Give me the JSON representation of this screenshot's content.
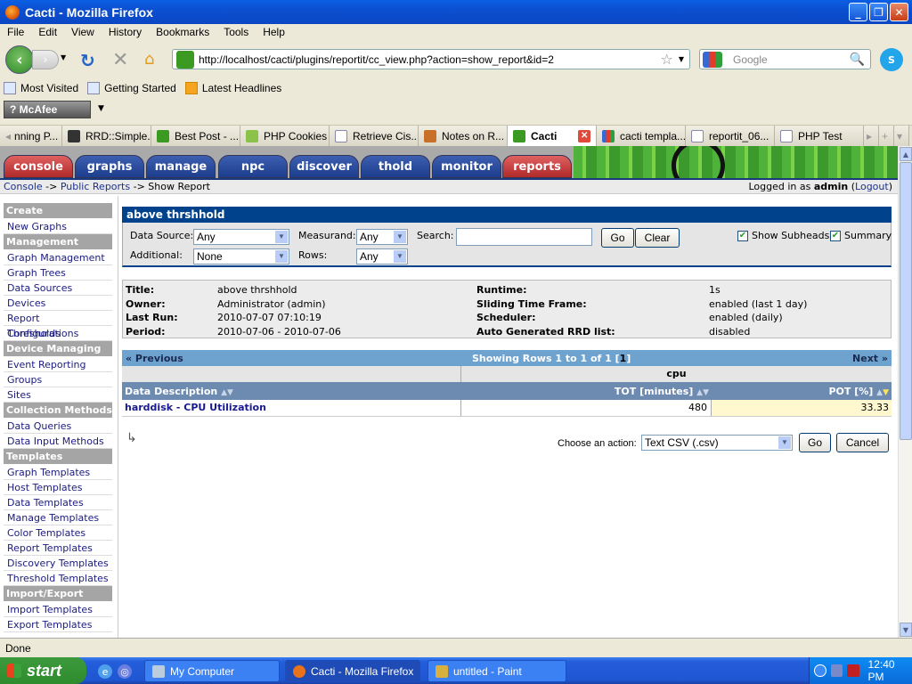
{
  "window": {
    "title": "Cacti - Mozilla Firefox"
  },
  "menu": [
    "File",
    "Edit",
    "View",
    "History",
    "Bookmarks",
    "Tools",
    "Help"
  ],
  "url": "http://localhost/cacti/plugins/reportit/cc_view.php?action=show_report&id=2",
  "search_placeholder": "Google",
  "bookmarks": [
    "Most Visited",
    "Getting Started",
    "Latest Headlines"
  ],
  "mcafee_label": "McAfee",
  "tabs": [
    {
      "label": "nning P..."
    },
    {
      "label": "RRD::Simple..."
    },
    {
      "label": "Best Post - ..."
    },
    {
      "label": "PHP Cookies"
    },
    {
      "label": "Retrieve Cis..."
    },
    {
      "label": "Notes on R..."
    },
    {
      "label": "Cacti",
      "active": true
    },
    {
      "label": "cacti templa..."
    },
    {
      "label": "reportit_06..."
    },
    {
      "label": "PHP Test"
    }
  ],
  "cacti_tabs": [
    "console",
    "graphs",
    "manage",
    "npc",
    "discover",
    "thold",
    "monitor",
    "reports"
  ],
  "breadcrumb": {
    "items": [
      "Console",
      "Public Reports"
    ],
    "current": "Show Report",
    "sep": "->"
  },
  "login": {
    "prefix": "Logged in as",
    "user": "admin",
    "logout": "Logout"
  },
  "sidebar": [
    {
      "type": "head",
      "label": "Create"
    },
    {
      "type": "item",
      "label": "New Graphs"
    },
    {
      "type": "head",
      "label": "Management"
    },
    {
      "type": "item",
      "label": "Graph Management"
    },
    {
      "type": "item",
      "label": "Graph Trees"
    },
    {
      "type": "item",
      "label": "Data Sources"
    },
    {
      "type": "item",
      "label": "Devices"
    },
    {
      "type": "item",
      "label": "Report Configurations"
    },
    {
      "type": "item",
      "label": "Thresholds"
    },
    {
      "type": "head",
      "label": "Device Managing"
    },
    {
      "type": "item",
      "label": "Event Reporting"
    },
    {
      "type": "item",
      "label": "Groups"
    },
    {
      "type": "item",
      "label": "Sites"
    },
    {
      "type": "head",
      "label": "Collection Methods"
    },
    {
      "type": "item",
      "label": "Data Queries"
    },
    {
      "type": "item",
      "label": "Data Input Methods"
    },
    {
      "type": "head",
      "label": "Templates"
    },
    {
      "type": "item",
      "label": "Graph Templates"
    },
    {
      "type": "item",
      "label": "Host Templates"
    },
    {
      "type": "item",
      "label": "Data Templates"
    },
    {
      "type": "item",
      "label": "Manage Templates"
    },
    {
      "type": "item",
      "label": "Color Templates"
    },
    {
      "type": "item",
      "label": "Report Templates"
    },
    {
      "type": "item",
      "label": "Discovery Templates"
    },
    {
      "type": "item",
      "label": "Threshold Templates"
    },
    {
      "type": "head",
      "label": "Import/Export"
    },
    {
      "type": "item",
      "label": "Import Templates"
    },
    {
      "type": "item",
      "label": "Export Templates"
    }
  ],
  "report": {
    "title": "above thrshhold",
    "filter": {
      "data_source_label": "Data Source:",
      "data_source": "Any",
      "measurand_label": "Measurand:",
      "measurand": "Any",
      "search_label": "Search:",
      "search_value": "",
      "additional_label": "Additional:",
      "additional": "None",
      "rows_label": "Rows:",
      "rows": "Any",
      "go": "Go",
      "clear": "Clear",
      "show_subheads": "Show Subheads",
      "summary": "Summary"
    },
    "info_left": [
      {
        "label": "Title:",
        "value": "above thrshhold"
      },
      {
        "label": "Owner:",
        "value": "Administrator (admin)"
      },
      {
        "label": "Last Run:",
        "value": "2010-07-07 07:10:19"
      },
      {
        "label": "Period:",
        "value": "2010-07-06 - 2010-07-06"
      }
    ],
    "info_right": [
      {
        "label": "Runtime:",
        "value": "1s"
      },
      {
        "label": "Sliding Time Frame:",
        "value": "enabled (last 1 day)"
      },
      {
        "label": "Scheduler:",
        "value": "enabled (daily)"
      },
      {
        "label": "Auto Generated RRD list:",
        "value": "disabled"
      }
    ],
    "nav": {
      "prev": "« Previous",
      "showing": "Showing Rows 1 to 1 of 1 [",
      "page": "1",
      "close": "]",
      "next": "Next »"
    },
    "subhead": "cpu",
    "columns": [
      "Data Description",
      "TOT [minutes]",
      "POT [%]"
    ],
    "rows": [
      {
        "desc": "harddisk - CPU Utilization",
        "tot": "480",
        "pot": "33.33"
      }
    ],
    "action": {
      "label": "Choose an action:",
      "selected": "Text CSV (.csv)",
      "go": "Go",
      "cancel": "Cancel"
    }
  },
  "status": "Done",
  "taskbar": {
    "start": "start",
    "tasks": [
      "My Computer",
      "Cacti - Mozilla Firefox",
      "untitled - Paint"
    ],
    "clock": "12:40 PM"
  }
}
